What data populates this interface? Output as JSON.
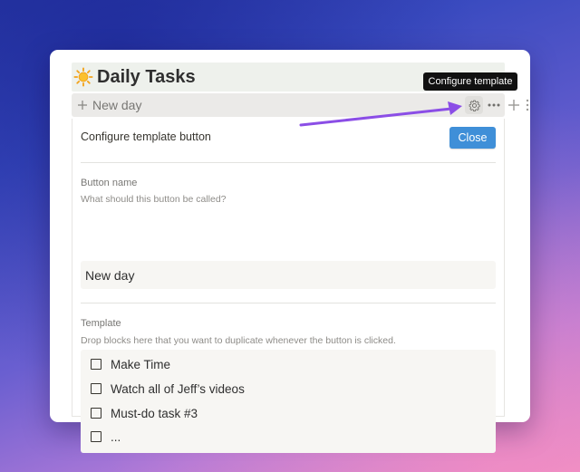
{
  "page": {
    "title_emoji": "sun-emoji",
    "title": "Daily Tasks"
  },
  "button_block": {
    "label": "New day",
    "plus_icon": "plus-icon",
    "gear_icon": "gear-icon",
    "more_icon": "ellipsis-icon"
  },
  "tooltip": {
    "text": "Configure template"
  },
  "config_panel": {
    "header": "Configure template button",
    "close_label": "Close",
    "close_color": "#3f8fd8",
    "button_name": {
      "label": "Button name",
      "hint": "What should this button be called?",
      "value": "New day"
    },
    "template": {
      "label": "Template",
      "hint": "Drop blocks here that you want to duplicate whenever the button is clicked.",
      "items": [
        {
          "text": "Make Time",
          "checked": false
        },
        {
          "text": "Watch all of Jeff’s videos",
          "checked": false
        },
        {
          "text": "Must-do task #3",
          "checked": false
        },
        {
          "text": "...",
          "checked": false
        }
      ]
    }
  },
  "colors": {
    "arrow": "#8b4ee6",
    "tooltip_bg": "#111111",
    "title_row_bg": "#eef1ec"
  }
}
